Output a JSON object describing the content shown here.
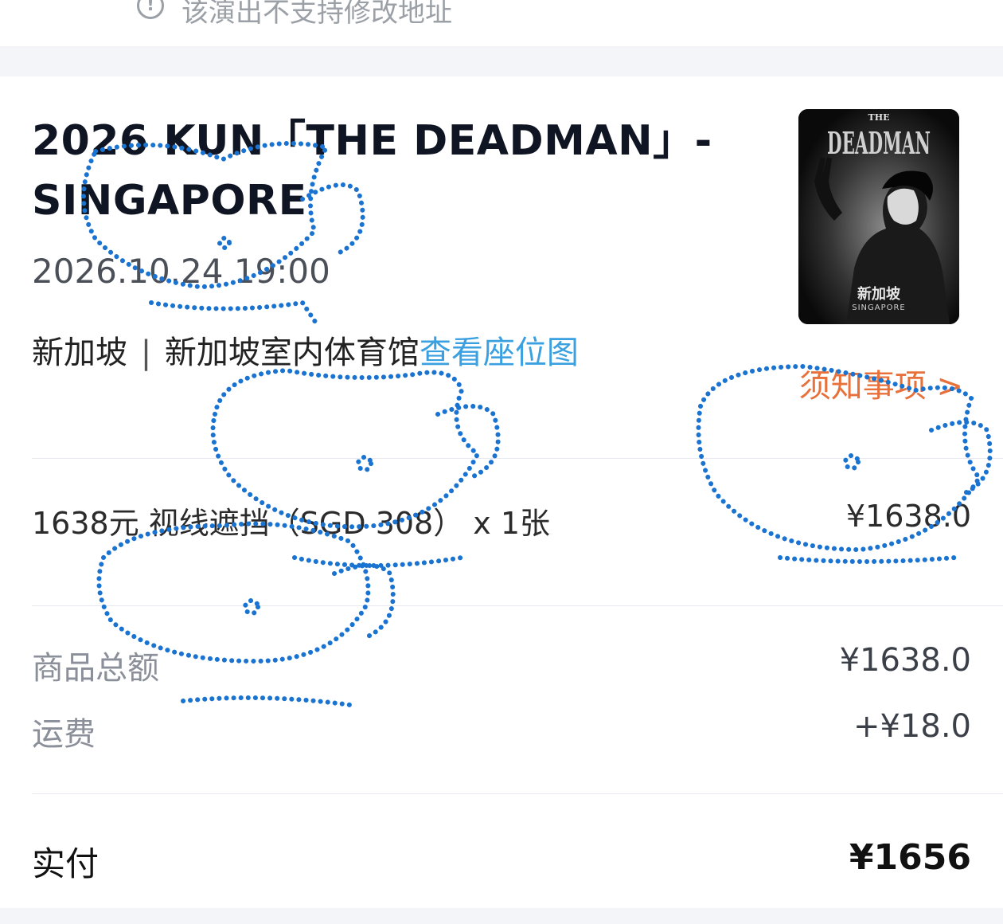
{
  "notice": {
    "text": "该演出不支持修改地址",
    "icon": "info-circle-icon"
  },
  "event": {
    "title": "2026 KUN「THE DEADMAN」- SINGAPORE",
    "datetime": "2026.10.24 19:00",
    "city": "新加坡",
    "separator": "|",
    "venue": "新加坡室内体育馆",
    "seat_map_link": "查看座位图",
    "notice_link": "须知事项 >",
    "poster": {
      "top_text": "THE",
      "headline": "DEADMAN",
      "city_cn": "新加坡",
      "city_en": "SINGAPORE"
    }
  },
  "ticket": {
    "description": "1638元 视线遮挡（SGD 308）  x 1张",
    "price": "¥1638.0"
  },
  "fees": [
    {
      "label": "商品总额",
      "value": "¥1638.0"
    },
    {
      "label": "运费",
      "value": "+¥18.0"
    }
  ],
  "payment": {
    "label": "实付",
    "value": "¥1656"
  },
  "colors": {
    "accent_link": "#3aa0e0",
    "notice_orange": "#e8703a",
    "watermark_blue": "#1a73d0",
    "band_gray": "#f4f5f9"
  }
}
